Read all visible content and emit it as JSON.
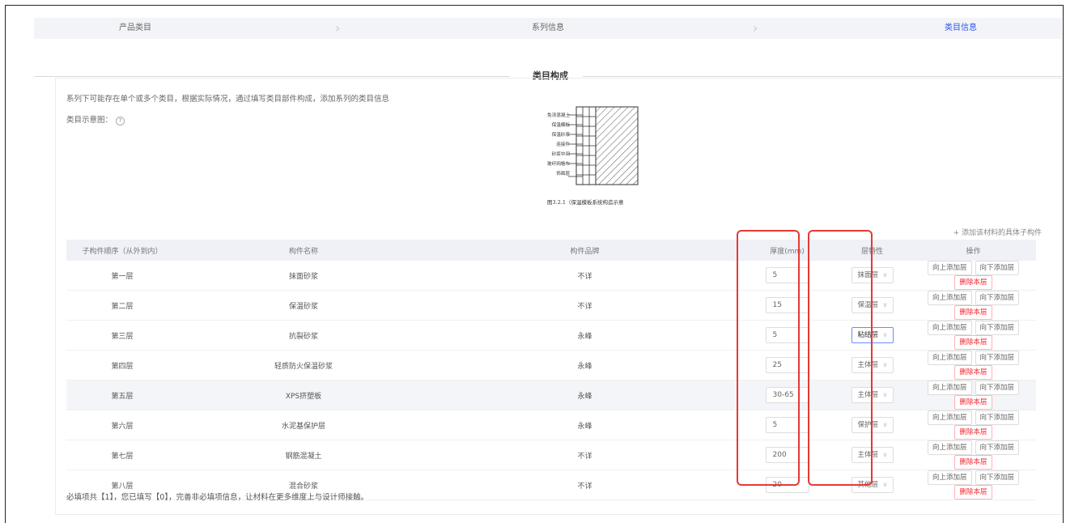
{
  "steps": [
    {
      "label": "产品类目",
      "active": false
    },
    {
      "label": "系列信息",
      "active": false
    },
    {
      "label": "类目信息",
      "active": true
    }
  ],
  "section_title": "类目构成",
  "description": "系列下可能存在单个或多个类目，根据实际情况，通过填写类目部件构成，添加系列的类目信息",
  "diagram_label": "类目示意图：",
  "diagram": {
    "layers": [
      "免浇混凝土",
      "保温模板",
      "保温砂浆",
      "连接件",
      "砂浆中间",
      "玻纤网格布",
      "饰面层"
    ],
    "caption": "图3.2.1（保温模板系统构造示意"
  },
  "add_link": "+ 添加该材料的具体子构件",
  "table": {
    "headers": [
      "子构件顺序（从外到内）",
      "构件名称",
      "构件品牌",
      "厚度(mm)",
      "层特性",
      "操作"
    ],
    "rows": [
      {
        "order": "第一层",
        "name": "抹面砂浆",
        "brand": "不详",
        "thickness": "5",
        "feature": "抹面层"
      },
      {
        "order": "第二层",
        "name": "保温砂浆",
        "brand": "不详",
        "thickness": "15",
        "feature": "保温层"
      },
      {
        "order": "第三层",
        "name": "抗裂砂浆",
        "brand": "永峰",
        "thickness": "5",
        "feature": "粘结层"
      },
      {
        "order": "第四层",
        "name": "轻质防火保温砂浆",
        "brand": "永峰",
        "thickness": "25",
        "feature": "主体层"
      },
      {
        "order": "第五层",
        "name": "XPS挤塑板",
        "brand": "永峰",
        "thickness": "30-65",
        "feature": "主体层"
      },
      {
        "order": "第六层",
        "name": "水泥基保护层",
        "brand": "永峰",
        "thickness": "5",
        "feature": "保护层"
      },
      {
        "order": "第七层",
        "name": "钢筋混凝土",
        "brand": "不详",
        "thickness": "200",
        "feature": "主体层"
      },
      {
        "order": "第八层",
        "name": "混合砂浆",
        "brand": "不详",
        "thickness": "20",
        "feature": "其他层"
      }
    ],
    "actions": {
      "add_up": "向上添加层",
      "add_down": "向下添加层",
      "delete": "删除本层"
    }
  },
  "footer": "必填项共【1】，您已填写【0】，完善非必填项信息，让材料在更多维度上与设计师接触。",
  "colors": {
    "accent": "#2f54eb",
    "danger": "#f5222d",
    "highlight": "#e53935"
  }
}
